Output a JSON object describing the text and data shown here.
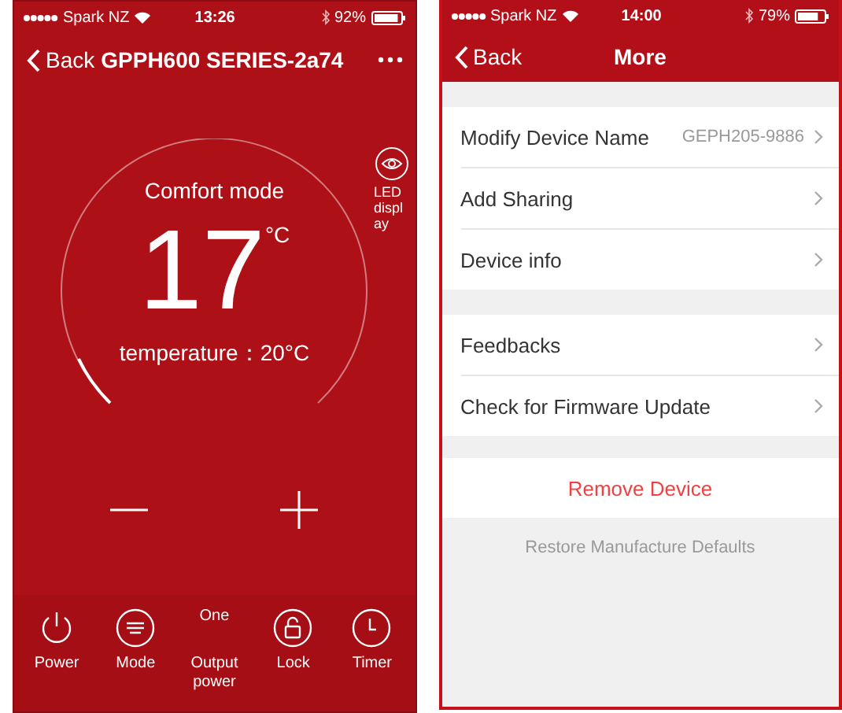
{
  "device_screen": {
    "status_bar": {
      "carrier": "Spark NZ",
      "time": "13:26",
      "battery": "92%"
    },
    "nav": {
      "back": "Back",
      "title": "GPPH600 SERIES-2a74"
    },
    "led_button": {
      "label": "LED display"
    },
    "dial": {
      "mode": "Comfort mode",
      "setpoint": "17",
      "unit": "°C",
      "current": "temperature：20°C"
    },
    "controls": [
      {
        "kind": "icon",
        "label": "Power"
      },
      {
        "kind": "icon",
        "label": "Mode"
      },
      {
        "kind": "value",
        "value": "One",
        "label": "Output power"
      },
      {
        "kind": "icon",
        "label": "Lock"
      },
      {
        "kind": "icon",
        "label": "Timer"
      }
    ]
  },
  "more_screen": {
    "status_bar": {
      "carrier": "Spark NZ",
      "time": "14:00",
      "battery": "79%"
    },
    "nav": {
      "back": "Back",
      "title": "More"
    },
    "groups": [
      [
        {
          "label": "Modify Device Name",
          "value": "GEPH205-9886"
        },
        {
          "label": "Add Sharing"
        },
        {
          "label": "Device info"
        }
      ],
      [
        {
          "label": "Feedbacks"
        },
        {
          "label": "Check for Firmware Update"
        }
      ]
    ],
    "remove_button": "Remove Device",
    "restore_link": "Restore Manufacture Defaults"
  }
}
